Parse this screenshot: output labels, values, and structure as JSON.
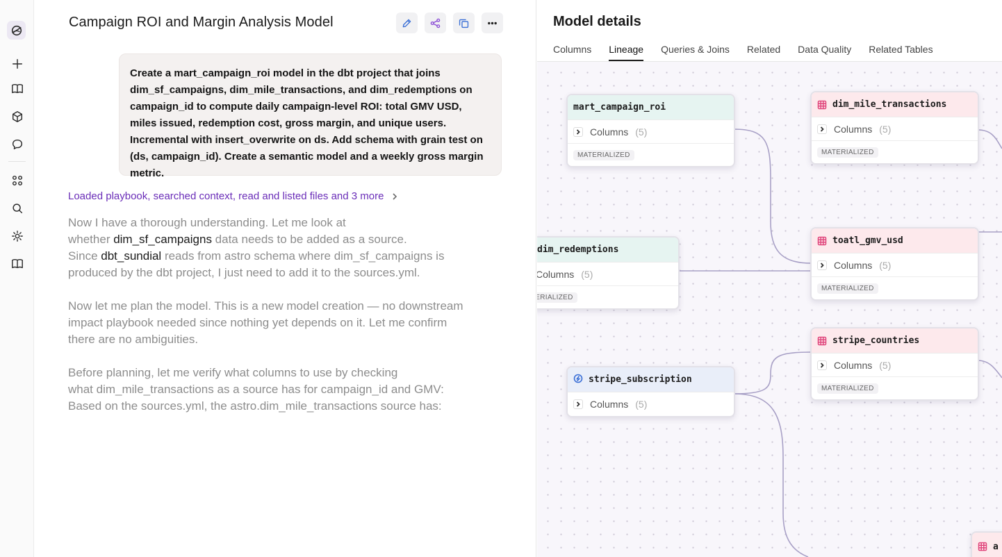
{
  "sidebar": {
    "logo": "app-logo",
    "items": [
      {
        "name": "new-chat-icon"
      },
      {
        "name": "book-icon"
      },
      {
        "name": "cube-icon"
      },
      {
        "name": "chat-bubble-icon"
      },
      {
        "name": "apps-grid-icon"
      },
      {
        "name": "search-icon"
      },
      {
        "name": "gear-icon"
      },
      {
        "name": "docs-icon"
      }
    ]
  },
  "chat": {
    "title": "Campaign ROI and Margin Analysis Model",
    "toolbar": [
      "edit-icon",
      "share-icon",
      "copy-icon",
      "more-icon"
    ],
    "prompt": "Create a mart_campaign_roi model in the dbt project that joins dim_sf_campaigns, dim_mile_transactions, and dim_redemptions on campaign_id to compute daily campaign-level ROI: total GMV USD, miles issued, redemption cost, gross margin, and unique users. Incremental with insert_overwrite on ds. Add schema with grain test on (ds, campaign_id). Create a semantic model and a weekly gross margin metric.",
    "activity": "Loaded playbook, searched context, read and listed files and 3 more",
    "p1": {
      "l1": "Now I have a thorough understanding. Let me look at",
      "l2a": "whether ",
      "l2b": "dim_sf_campaigns",
      "l2c": " data needs to be added as a source.",
      "l3a": "Since ",
      "l3b": "dbt_sundial",
      "l3c": " reads from astro schema where dim_sf_campaigns is",
      "l4": "produced by the dbt project, I just need to add it to the sources.yml."
    },
    "p2": {
      "l1": "Now let me plan the model. This is a new model creation — no downstream",
      "l2": "impact playbook needed since nothing yet depends on it. Let me confirm",
      "l3": "there are no ambiguities."
    },
    "p3": {
      "l1": "Before planning, let me verify what columns to use by checking",
      "l2": "what dim_mile_transactions as a source has for campaign_id and GMV:",
      "l3": "Based on the sources.yml, the astro.dim_mile_transactions source has:"
    }
  },
  "details": {
    "title": "Model details",
    "tabs": [
      "Columns",
      "Lineage",
      "Queries & Joins",
      "Related",
      "Data Quality",
      "Related Tables"
    ],
    "active_tab": "Lineage",
    "nodes": {
      "mart": {
        "name": "mart_campaign_roi",
        "columns_label": "Columns",
        "columns_count": "(5)",
        "badge": "MATERIALIZED"
      },
      "mile": {
        "name": "dim_mile_transactions",
        "columns_label": "Columns",
        "columns_count": "(5)",
        "badge": "MATERIALIZED"
      },
      "redemptions": {
        "name": "dim_redemptions",
        "columns_label": "Columns",
        "columns_count": "(5)",
        "badge": "MATERIALIZED"
      },
      "gmv": {
        "name": "toatl_gmv_usd",
        "columns_label": "Columns",
        "columns_count": "(5)",
        "badge": "MATERIALIZED"
      },
      "stripe_sub": {
        "name": "stripe_subscription",
        "columns_label": "Columns",
        "columns_count": "(5)"
      },
      "stripe_countries": {
        "name": "stripe_countries",
        "columns_label": "Columns",
        "columns_count": "(5)",
        "badge": "MATERIALIZED"
      },
      "partial": {
        "name": "a"
      }
    }
  }
}
